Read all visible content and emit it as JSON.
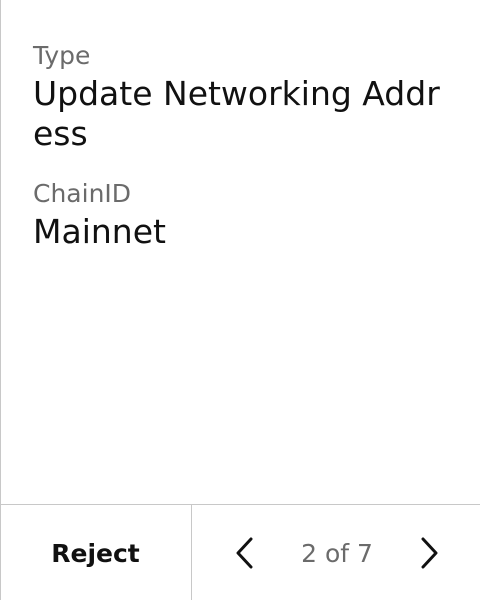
{
  "fields": [
    {
      "label": "Type",
      "value": "Update Networking Address"
    },
    {
      "label": "ChainID",
      "value": "Mainnet"
    }
  ],
  "footer": {
    "reject_label": "Reject",
    "page_indicator": "2 of 7",
    "prev_icon": "chevron-left-icon",
    "next_icon": "chevron-right-icon"
  }
}
